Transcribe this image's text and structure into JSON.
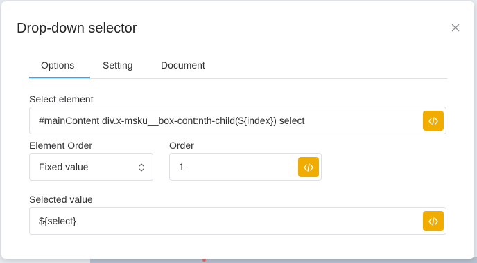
{
  "dialog": {
    "title": "Drop-down selector",
    "close_icon": "close-icon"
  },
  "tabs": [
    {
      "label": "Options",
      "active": true
    },
    {
      "label": "Setting",
      "active": false
    },
    {
      "label": "Document",
      "active": false
    }
  ],
  "fields": {
    "select_element": {
      "label": "Select element",
      "value": "#mainContent div.x-msku__box-cont:nth-child(${index}) select",
      "action_icon": "code-icon"
    },
    "element_order": {
      "label": "Element Order",
      "value": "Fixed value",
      "arrow_icon": "chevron-up-down-icon"
    },
    "order": {
      "label": "Order",
      "value": "1",
      "action_icon": "code-icon"
    },
    "selected_value": {
      "label": "Selected value",
      "value": "${select}",
      "action_icon": "code-icon"
    }
  },
  "colors": {
    "accent": "#409eff",
    "code_button": "#f0ad00"
  }
}
